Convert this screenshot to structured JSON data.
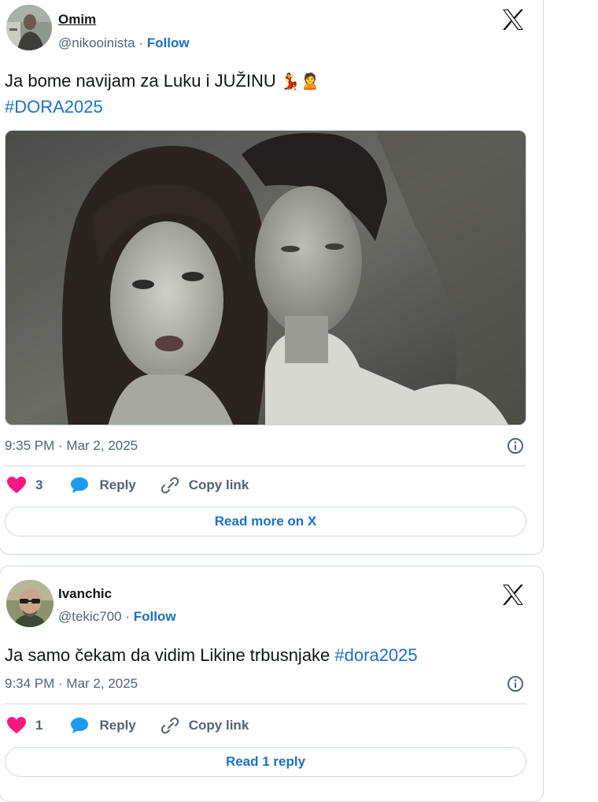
{
  "tweets": [
    {
      "author_name": "Omim",
      "handle": "@nikooinista",
      "separator": "·",
      "follow_label": "Follow",
      "text_line1": "Ja bome navijam za Luku i JUŽINU",
      "text_emojis": "💃🙎",
      "hashtag": "#DORA2025",
      "timestamp": "9:35 PM · Mar 2, 2025",
      "like_count": "3",
      "reply_label": "Reply",
      "copy_label": "Copy link",
      "cta_label": "Read more on X"
    },
    {
      "author_name": "Ivanchic",
      "handle": "@tekic700",
      "separator": "·",
      "follow_label": "Follow",
      "text": "Ja samo čekam da vidim Likine trbusnjake",
      "hashtag": "#dora2025",
      "timestamp": "9:34 PM · Mar 2, 2025",
      "like_count": "1",
      "reply_label": "Reply",
      "copy_label": "Copy link",
      "cta_label": "Read 1 reply"
    }
  ],
  "colors": {
    "link": "#1d6fc7",
    "heart": "#f91880",
    "secondary_text": "#536471",
    "border": "#cfd9de",
    "reply_bubble": "#1d9bf0"
  },
  "icons": [
    "x-logo-icon",
    "info-icon",
    "heart-icon",
    "reply-bubble-icon",
    "link-icon"
  ]
}
